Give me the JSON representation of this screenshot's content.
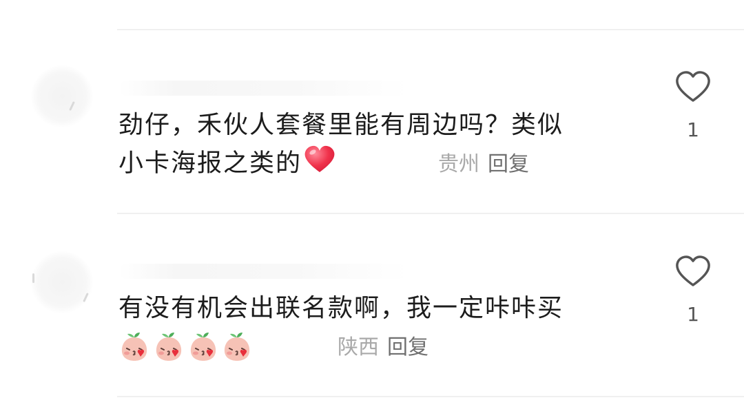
{
  "comments": [
    {
      "lines": [
        "劲仔，禾伙人套餐里能有周边吗？类似",
        "小卡海报之类的"
      ],
      "location": "贵州",
      "reply_label": "回复",
      "like_count": "1",
      "trailing_emoji": "red-heart-emoji"
    },
    {
      "lines": [
        "有没有机会出联名款啊，我一定咔咔买"
      ],
      "location": "陕西",
      "reply_label": "回复",
      "like_count": "1",
      "stickers": [
        "peach-kiss-sticker",
        "peach-kiss-sticker",
        "peach-kiss-sticker",
        "peach-kiss-sticker"
      ]
    }
  ],
  "colors": {
    "text": "#1c1c1c",
    "location": "#a9a9a9",
    "reply": "#6f6f6f",
    "heart_emoji": "#f0324b",
    "like_icon": "#555555"
  }
}
